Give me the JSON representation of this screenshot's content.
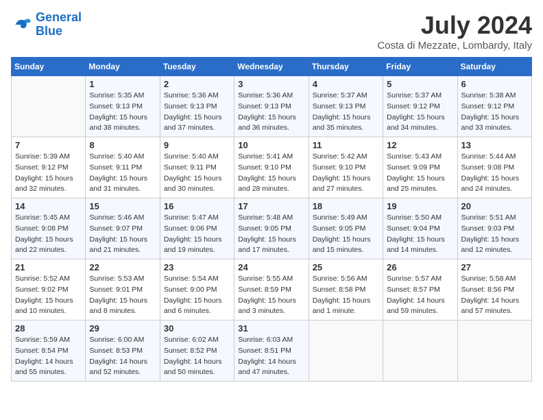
{
  "header": {
    "logo_line1": "General",
    "logo_line2": "Blue",
    "month_year": "July 2024",
    "location": "Costa di Mezzate, Lombardy, Italy"
  },
  "days_of_week": [
    "Sunday",
    "Monday",
    "Tuesday",
    "Wednesday",
    "Thursday",
    "Friday",
    "Saturday"
  ],
  "weeks": [
    [
      {
        "day": "",
        "info": ""
      },
      {
        "day": "1",
        "info": "Sunrise: 5:35 AM\nSunset: 9:13 PM\nDaylight: 15 hours\nand 38 minutes."
      },
      {
        "day": "2",
        "info": "Sunrise: 5:36 AM\nSunset: 9:13 PM\nDaylight: 15 hours\nand 37 minutes."
      },
      {
        "day": "3",
        "info": "Sunrise: 5:36 AM\nSunset: 9:13 PM\nDaylight: 15 hours\nand 36 minutes."
      },
      {
        "day": "4",
        "info": "Sunrise: 5:37 AM\nSunset: 9:13 PM\nDaylight: 15 hours\nand 35 minutes."
      },
      {
        "day": "5",
        "info": "Sunrise: 5:37 AM\nSunset: 9:12 PM\nDaylight: 15 hours\nand 34 minutes."
      },
      {
        "day": "6",
        "info": "Sunrise: 5:38 AM\nSunset: 9:12 PM\nDaylight: 15 hours\nand 33 minutes."
      }
    ],
    [
      {
        "day": "7",
        "info": "Sunrise: 5:39 AM\nSunset: 9:12 PM\nDaylight: 15 hours\nand 32 minutes."
      },
      {
        "day": "8",
        "info": "Sunrise: 5:40 AM\nSunset: 9:11 PM\nDaylight: 15 hours\nand 31 minutes."
      },
      {
        "day": "9",
        "info": "Sunrise: 5:40 AM\nSunset: 9:11 PM\nDaylight: 15 hours\nand 30 minutes."
      },
      {
        "day": "10",
        "info": "Sunrise: 5:41 AM\nSunset: 9:10 PM\nDaylight: 15 hours\nand 28 minutes."
      },
      {
        "day": "11",
        "info": "Sunrise: 5:42 AM\nSunset: 9:10 PM\nDaylight: 15 hours\nand 27 minutes."
      },
      {
        "day": "12",
        "info": "Sunrise: 5:43 AM\nSunset: 9:09 PM\nDaylight: 15 hours\nand 25 minutes."
      },
      {
        "day": "13",
        "info": "Sunrise: 5:44 AM\nSunset: 9:08 PM\nDaylight: 15 hours\nand 24 minutes."
      }
    ],
    [
      {
        "day": "14",
        "info": "Sunrise: 5:45 AM\nSunset: 9:08 PM\nDaylight: 15 hours\nand 22 minutes."
      },
      {
        "day": "15",
        "info": "Sunrise: 5:46 AM\nSunset: 9:07 PM\nDaylight: 15 hours\nand 21 minutes."
      },
      {
        "day": "16",
        "info": "Sunrise: 5:47 AM\nSunset: 9:06 PM\nDaylight: 15 hours\nand 19 minutes."
      },
      {
        "day": "17",
        "info": "Sunrise: 5:48 AM\nSunset: 9:05 PM\nDaylight: 15 hours\nand 17 minutes."
      },
      {
        "day": "18",
        "info": "Sunrise: 5:49 AM\nSunset: 9:05 PM\nDaylight: 15 hours\nand 15 minutes."
      },
      {
        "day": "19",
        "info": "Sunrise: 5:50 AM\nSunset: 9:04 PM\nDaylight: 15 hours\nand 14 minutes."
      },
      {
        "day": "20",
        "info": "Sunrise: 5:51 AM\nSunset: 9:03 PM\nDaylight: 15 hours\nand 12 minutes."
      }
    ],
    [
      {
        "day": "21",
        "info": "Sunrise: 5:52 AM\nSunset: 9:02 PM\nDaylight: 15 hours\nand 10 minutes."
      },
      {
        "day": "22",
        "info": "Sunrise: 5:53 AM\nSunset: 9:01 PM\nDaylight: 15 hours\nand 8 minutes."
      },
      {
        "day": "23",
        "info": "Sunrise: 5:54 AM\nSunset: 9:00 PM\nDaylight: 15 hours\nand 6 minutes."
      },
      {
        "day": "24",
        "info": "Sunrise: 5:55 AM\nSunset: 8:59 PM\nDaylight: 15 hours\nand 3 minutes."
      },
      {
        "day": "25",
        "info": "Sunrise: 5:56 AM\nSunset: 8:58 PM\nDaylight: 15 hours\nand 1 minute."
      },
      {
        "day": "26",
        "info": "Sunrise: 5:57 AM\nSunset: 8:57 PM\nDaylight: 14 hours\nand 59 minutes."
      },
      {
        "day": "27",
        "info": "Sunrise: 5:58 AM\nSunset: 8:56 PM\nDaylight: 14 hours\nand 57 minutes."
      }
    ],
    [
      {
        "day": "28",
        "info": "Sunrise: 5:59 AM\nSunset: 8:54 PM\nDaylight: 14 hours\nand 55 minutes."
      },
      {
        "day": "29",
        "info": "Sunrise: 6:00 AM\nSunset: 8:53 PM\nDaylight: 14 hours\nand 52 minutes."
      },
      {
        "day": "30",
        "info": "Sunrise: 6:02 AM\nSunset: 8:52 PM\nDaylight: 14 hours\nand 50 minutes."
      },
      {
        "day": "31",
        "info": "Sunrise: 6:03 AM\nSunset: 8:51 PM\nDaylight: 14 hours\nand 47 minutes."
      },
      {
        "day": "",
        "info": ""
      },
      {
        "day": "",
        "info": ""
      },
      {
        "day": "",
        "info": ""
      }
    ]
  ]
}
